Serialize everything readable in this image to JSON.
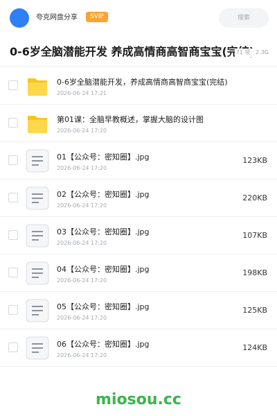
{
  "header": {
    "app_name": "夸克网盘分享",
    "vip_badge": "SVIP",
    "search_placeholder": "搜索",
    "accent_color": "#2f7ff5"
  },
  "folder": {
    "title": "0-6岁全脑潜能开发 养成高情商高智商宝宝(完结)",
    "meta": "71 项 · 2.3G"
  },
  "files": [
    {
      "type": "folder",
      "icon": "folder-icon",
      "name": "0-6岁全脑潜能开发，养成高情商高智商宝宝(完结)",
      "date": "2026-06-24 17:21",
      "size": ""
    },
    {
      "type": "folder",
      "icon": "folder-icon",
      "name": "第01课：全脑早教概述，掌握大脑的设计图",
      "date": "2026-06-24 17:20",
      "size": ""
    },
    {
      "type": "file",
      "icon": "document-icon",
      "name": "01【公众号：密知圈】.jpg",
      "date": "2026-06-24 17:20",
      "size": "123KB"
    },
    {
      "type": "file",
      "icon": "document-icon",
      "name": "02【公众号：密知圈】.jpg",
      "date": "2026-06-24 17:20",
      "size": "220KB"
    },
    {
      "type": "file",
      "icon": "document-icon",
      "name": "03【公众号：密知圈】.jpg",
      "date": "2026-06-24 17:20",
      "size": "107KB"
    },
    {
      "type": "file",
      "icon": "document-icon",
      "name": "04【公众号：密知圈】.jpg",
      "date": "2026-06-24 17:20",
      "size": "198KB"
    },
    {
      "type": "file",
      "icon": "document-icon",
      "name": "05【公众号：密知圈】.jpg",
      "date": "2026-06-24 17:20",
      "size": "125KB"
    },
    {
      "type": "file",
      "icon": "document-icon",
      "name": "06【公众号：密知圈】.jpg",
      "date": "2026-06-24 17:20",
      "size": "124KB"
    }
  ],
  "watermark": {
    "text": "miosou.cc",
    "color": "#3bb54a"
  }
}
